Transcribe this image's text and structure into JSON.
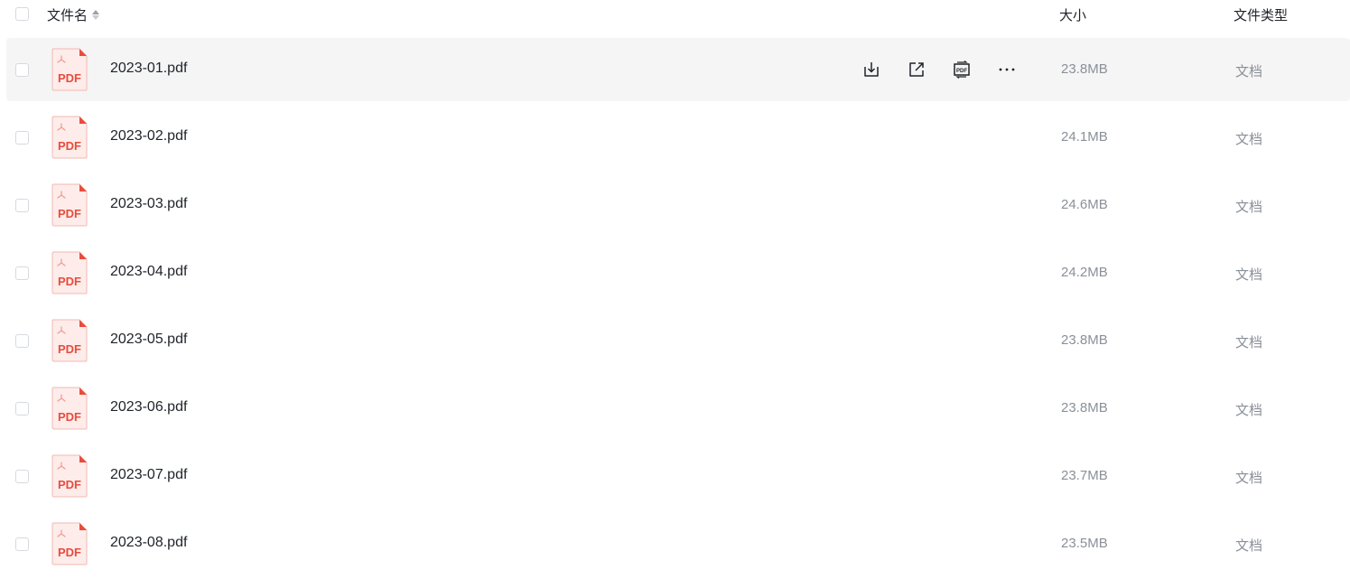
{
  "header": {
    "name_label": "文件名",
    "size_label": "大小",
    "type_label": "文件类型"
  },
  "row_icon_label": "PDF",
  "actions": {
    "download": "download-icon",
    "share": "share-icon",
    "pdf_convert": "pdf-convert-icon",
    "more": "more-icon"
  },
  "files": [
    {
      "name": "2023-01.pdf",
      "size": "23.8MB",
      "type": "文档"
    },
    {
      "name": "2023-02.pdf",
      "size": "24.1MB",
      "type": "文档"
    },
    {
      "name": "2023-03.pdf",
      "size": "24.6MB",
      "type": "文档"
    },
    {
      "name": "2023-04.pdf",
      "size": "24.2MB",
      "type": "文档"
    },
    {
      "name": "2023-05.pdf",
      "size": "23.8MB",
      "type": "文档"
    },
    {
      "name": "2023-06.pdf",
      "size": "23.8MB",
      "type": "文档"
    },
    {
      "name": "2023-07.pdf",
      "size": "23.7MB",
      "type": "文档"
    },
    {
      "name": "2023-08.pdf",
      "size": "23.5MB",
      "type": "文档"
    }
  ],
  "colors": {
    "pdf_red": "#e84c3d",
    "pdf_bg": "#fdecea",
    "row_hover": "#f5f5f5",
    "muted_text": "#8a9099"
  }
}
